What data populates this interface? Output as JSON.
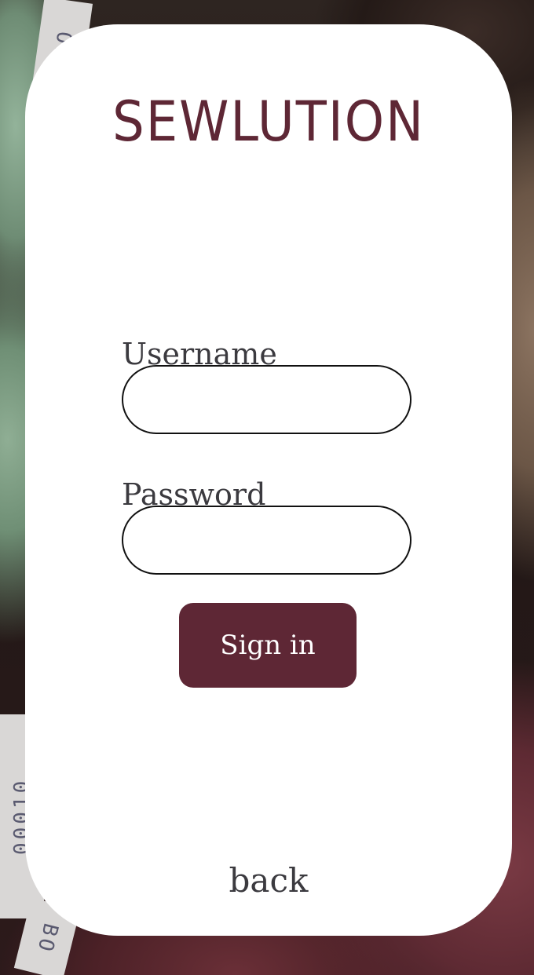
{
  "background": {
    "description_icon": "thread-spools-photo",
    "spool_labels": [
      "OL",
      "00010",
      "BO"
    ]
  },
  "card": {
    "brand_title": "SEWLUTION",
    "username": {
      "label": "Username",
      "value": "",
      "placeholder": ""
    },
    "password": {
      "label": "Password",
      "value": "",
      "placeholder": ""
    },
    "signin_label": "Sign in",
    "back_label": "back"
  },
  "colors": {
    "brand": "#5e2735",
    "button_bg": "#5e2735",
    "text": "#3b3a3f",
    "card_bg": "#ffffff"
  }
}
